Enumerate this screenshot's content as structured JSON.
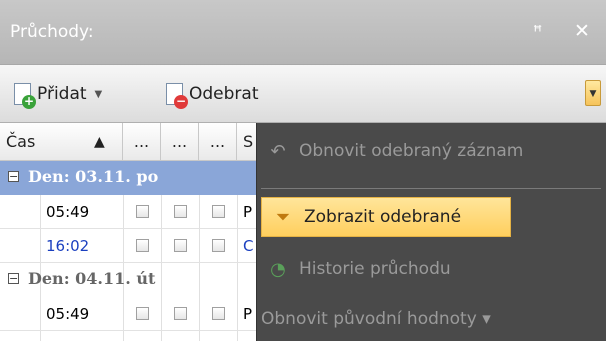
{
  "panel": {
    "title": "Průchody:",
    "pin_icon": "pin-icon",
    "close_icon": "close-icon"
  },
  "toolbar": {
    "add_label": "Přidat",
    "remove_label": "Odebrat",
    "overflow_icon": "chevron-down-icon"
  },
  "grid": {
    "columns": [
      "Čas",
      "...",
      "...",
      "...",
      "S"
    ],
    "sort_indicator": "▲",
    "groups": [
      {
        "label": "Den: 03.11. po",
        "rows": [
          {
            "time": "05:49",
            "tail": "P",
            "time_color": "#000000"
          },
          {
            "time": "16:02",
            "tail": "C",
            "time_color": "#1a3fbf"
          }
        ]
      },
      {
        "label": "Den: 04.11. út",
        "rows": [
          {
            "time": "05:49",
            "tail": "P",
            "time_color": "#000000"
          }
        ]
      }
    ]
  },
  "context_menu": {
    "items": [
      {
        "label": "Obnovit odebraný záznam",
        "icon": "undo-icon",
        "state": "disabled"
      },
      {
        "label": "Zobrazit odebrané",
        "icon": "filter-icon",
        "state": "highlighted"
      },
      {
        "label": "Historie průchodu",
        "icon": "history-icon",
        "state": "disabled"
      },
      {
        "label": "Obnovit původní hodnoty ▾",
        "icon": "",
        "state": "disabled"
      }
    ]
  },
  "colors": {
    "selected_group": "#8aa6d8",
    "menu_bg": "#4a4a4a",
    "highlight": "#ffcf5e"
  }
}
